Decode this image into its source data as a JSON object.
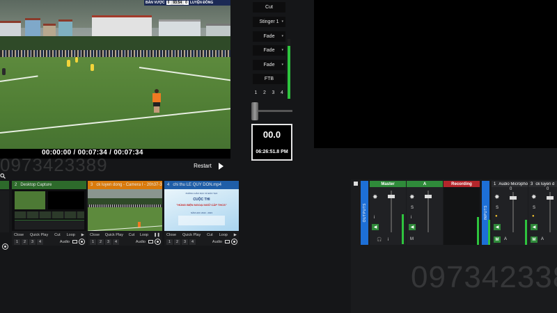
{
  "preview": {
    "scoreboard": {
      "team_home": "BẢN VƯỢC",
      "score_home": "0",
      "clock": "93:54",
      "score_away": "0",
      "team_away": "LUYỆN ĐỒNG"
    },
    "timecode": "00:00:00 / 00:07:34 / 00:07:34",
    "restart_label": "Restart"
  },
  "watermarks": {
    "left": "0973423389",
    "right": "097342338"
  },
  "transitions": {
    "buttons": [
      {
        "label": "Cut",
        "dropdown": false
      },
      {
        "label": "Stinger 1",
        "dropdown": true
      },
      {
        "label": "Fade",
        "dropdown": true
      },
      {
        "label": "Fade",
        "dropdown": true
      },
      {
        "label": "Fade",
        "dropdown": true
      },
      {
        "label": "FTB",
        "dropdown": false
      }
    ],
    "numbers": [
      "1",
      "2",
      "3",
      "4"
    ],
    "tbar_level": 0.88,
    "clock_main": "00.0",
    "clock_time": "06:26:51.8 PM"
  },
  "inputs": [
    {
      "number": "2",
      "title": "Desktop Capture",
      "head_color": "#2d6a2b",
      "controls": [
        "Close",
        "Quick Play",
        "Cut",
        "Loop"
      ],
      "nums": [
        "1",
        "2",
        "3",
        "4"
      ],
      "audio": "Audio"
    },
    {
      "number": "3",
      "title": "ck luyen dong - Camera I - 20h37-36 ...",
      "head_color": "#d97a0c",
      "controls": [
        "Close",
        "Quick Play",
        "Cut",
        "Loop"
      ],
      "nums": [
        "1",
        "2",
        "3",
        "4"
      ],
      "audio": "Audio"
    },
    {
      "number": "4",
      "title": "chi thu LE QUY DON.mp4",
      "head_color": "#1f5ea8",
      "controls": [
        "Close",
        "Quick Play",
        "Cut",
        "Loop"
      ],
      "nums": [
        "1",
        "2",
        "3",
        "4"
      ],
      "audio": "Audio"
    }
  ],
  "slide": {
    "line1": "PHÒNG GIÁO DỤC VÀ ĐÀO TẠO",
    "line2": "CUỘC THI",
    "line3": "\"HÙNG BIỆN NGOẠI NGỮ CẤP THCS\"",
    "line4": "NĂM HỌC 2022 - 2023"
  },
  "mixer": {
    "outputs_label": "OUTPUTS",
    "inputs_label": "INPUTS",
    "master_label": "Master",
    "a_label": "A",
    "recording_label": "Recording",
    "input_strips": [
      {
        "number": "1",
        "name": "Audio Micropho",
        "value": "0"
      },
      {
        "number": "3",
        "name": "ck luyen d",
        "value": "0"
      }
    ],
    "solo_label": "S",
    "info_label": "i",
    "mute_label": "M",
    "bus_label": "A",
    "colors": {
      "master": "#2f8a3a",
      "a": "#2f8a3a",
      "recording": "#b3262b",
      "accent": "#1d6fd6"
    }
  }
}
